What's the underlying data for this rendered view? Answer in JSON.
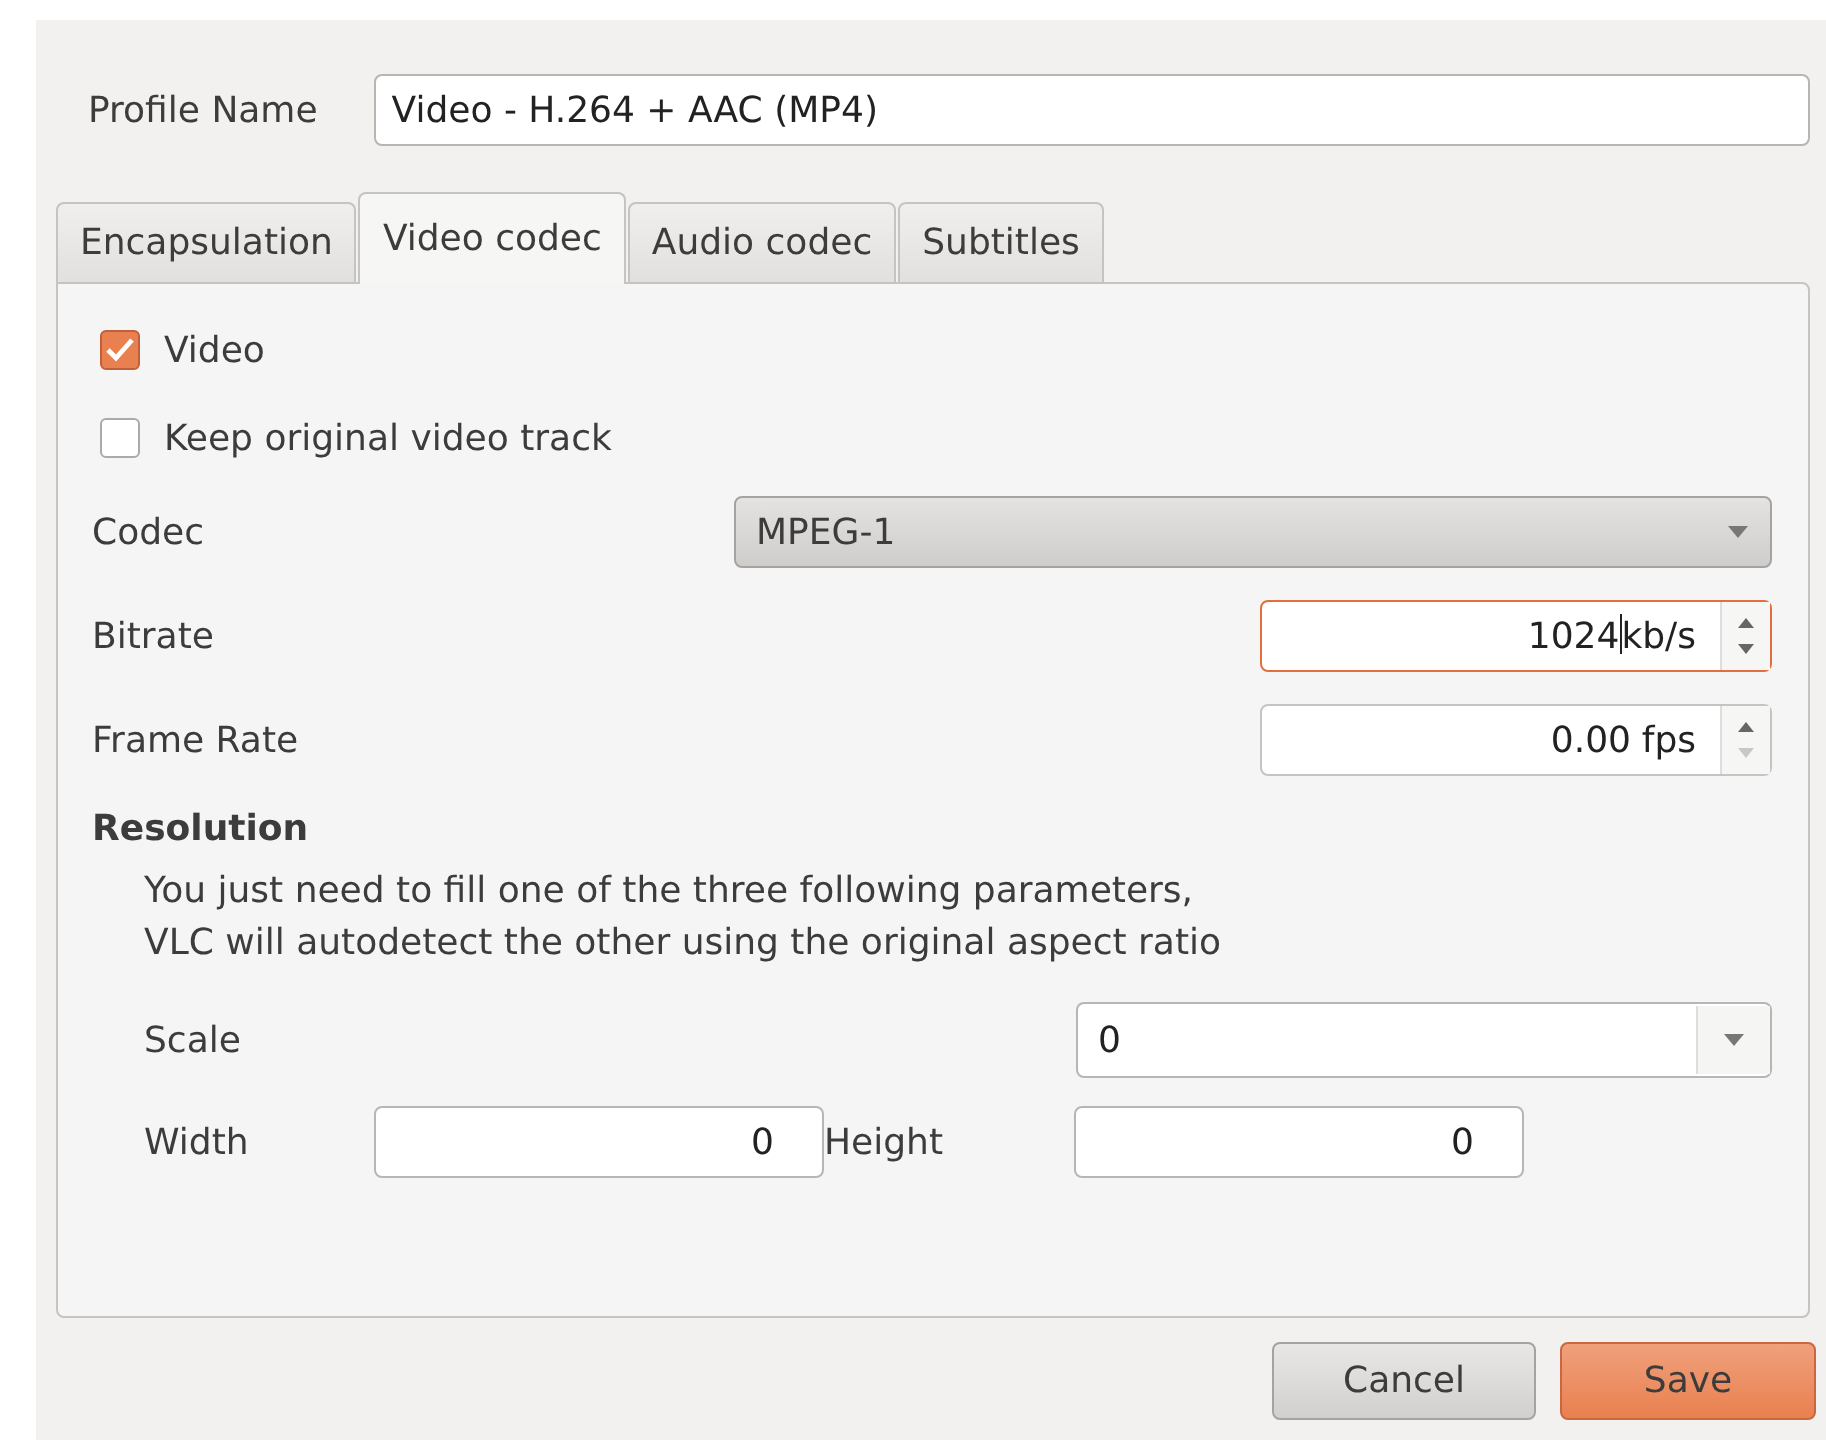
{
  "profile": {
    "label": "Profile Name",
    "value": "Video - H.264 + AAC (MP4)"
  },
  "tabs": [
    {
      "label": "Encapsulation",
      "selected": false
    },
    {
      "label": "Video codec",
      "selected": true
    },
    {
      "label": "Audio codec",
      "selected": false
    },
    {
      "label": "Subtitles",
      "selected": false
    }
  ],
  "options": [
    {
      "label": "Video",
      "checked": true
    },
    {
      "label": "Keep original video track",
      "checked": false
    }
  ],
  "settings": [
    {
      "kind": "combo",
      "label": "Codec",
      "value": "MPEG-1"
    },
    {
      "kind": "spin",
      "label": "Bitrate",
      "value": "1024",
      "suffix": "kb/s",
      "focused": true,
      "down_disabled": false
    },
    {
      "kind": "spin",
      "label": "Frame Rate",
      "value": "0.00",
      "suffix": "fps",
      "focused": false,
      "down_disabled": true
    }
  ],
  "resolution": {
    "title": "Resolution",
    "hint": "You just need to fill one of the three following parameters, VLC will autodetect the other using the original aspect ratio",
    "scale": {
      "label": "Scale",
      "value": "0"
    },
    "width": {
      "label": "Width",
      "value": "0"
    },
    "height": {
      "label": "Height",
      "value": "0"
    }
  },
  "buttons": [
    {
      "label": "Cancel",
      "kind": "secondary"
    },
    {
      "label": "Save",
      "kind": "default"
    }
  ]
}
